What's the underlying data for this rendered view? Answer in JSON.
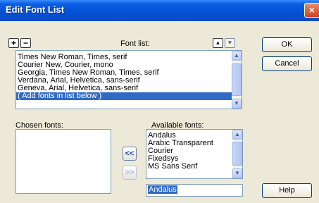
{
  "window": {
    "title": "Edit Font List"
  },
  "font_list": {
    "label": "Font list:",
    "add_glyph": "+",
    "remove_glyph": "−",
    "up_glyph": "▲",
    "down_glyph": "▼",
    "items": [
      "Times New Roman, Times, serif",
      "Courier New, Courier, mono",
      "Georgia, Times New Roman, Times, serif",
      "Verdana, Arial, Helvetica, sans-serif",
      "Geneva, Arial, Helvetica, sans-serif",
      "( Add fonts in list below )"
    ],
    "selected_index": 5
  },
  "chosen_fonts": {
    "label": "Chosen fonts:",
    "items": []
  },
  "transfer": {
    "add_glyph": "<<",
    "remove_glyph": ">>"
  },
  "available_fonts": {
    "label": "Available fonts:",
    "items": [
      "Andalus",
      "Arabic Transparent",
      "Courier",
      "Fixedsys",
      "MS Sans Serif"
    ],
    "input_value": "Andalus"
  },
  "buttons": {
    "ok": "OK",
    "cancel": "Cancel",
    "help": "Help"
  },
  "icons": {
    "close": "×",
    "scroll_up": "▲",
    "scroll_down": "▼"
  },
  "colors": {
    "titlebar": "#0550d6",
    "selection": "#316ac5",
    "dialog_bg": "#ece9d8"
  }
}
